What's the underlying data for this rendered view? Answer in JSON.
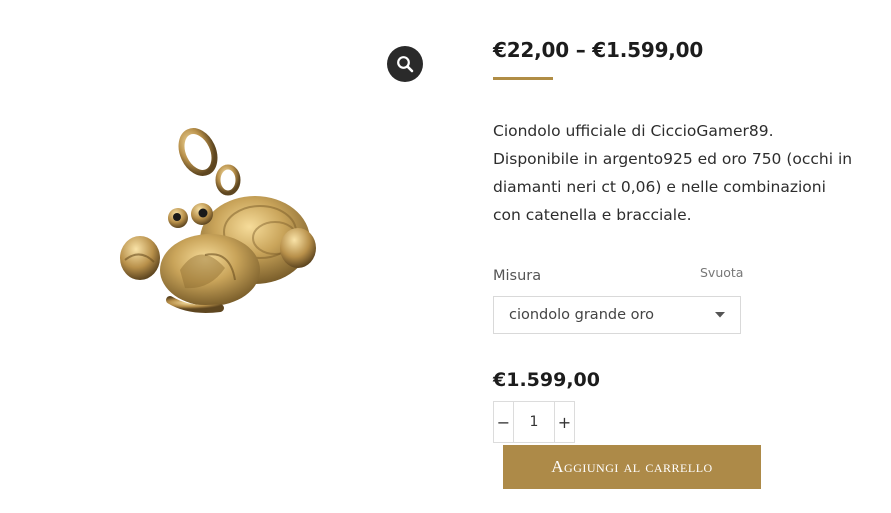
{
  "zoom": {
    "icon": "magnifier-icon"
  },
  "product": {
    "image_alt": "crab pendant",
    "price_range": "€22,00 – €1.599,00",
    "description": "Ciondolo ufficiale di CiccioGamer89. Disponibile in argento925 ed oro 750 (occhi in diamanti neri ct 0,06) e nelle combinazioni con catenella e bracciale."
  },
  "variation": {
    "label": "Misura",
    "clear_label": "Svuota",
    "selected": "ciondolo grande oro",
    "icon": "chevron-down-icon"
  },
  "selected_price": "€1.599,00",
  "quantity": {
    "minus": "−",
    "value": "1",
    "plus": "+"
  },
  "add_to_cart": "Aggiungi al carrello",
  "colors": {
    "accent": "#ad8a48",
    "underline": "#b08d45"
  }
}
